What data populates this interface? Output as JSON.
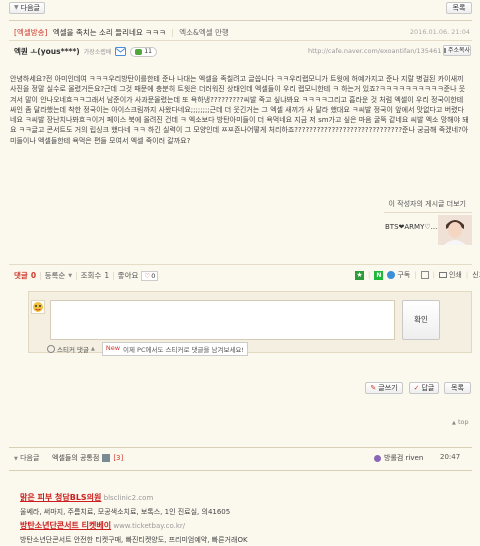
{
  "top_nav": {
    "prev_label": "다음글",
    "list_label": "목록"
  },
  "post": {
    "category": "[엑셀방송]",
    "title": "엑셀을 족치는 소리 들리네요 ㅋㅋㅋ",
    "board": "엑소&엑셀 만행",
    "date": "2016.01.06. 21:04",
    "author": "엑퀀 ㅗ(yous****)",
    "author_grade": "가장소렙배",
    "comment_count": "11",
    "url": "http://cafe.naver.com/exoantifan/135461",
    "copy_url_label": "주소복사",
    "body": "안녕하세요?전 아미인데여 ㅋㅋㅋ우리방탄이를한테 준나 나대는 엑셀을 족칠려고 글씁니다 ㅋㅋ우리랩모니가 트윗에 허예가지고 준나 지랄 병걸된 카이새끼 사진을 정말 실수로 올렸거든요?근데 그것 때문에 충분히 트윗은 더러워진 상태인데 엑셀들이 우리 랩모니한테 ㅋ 하는거 있죠?ㅋㅋㅋㅋㅋㅋㅋㅋㅋㅋ준나 웃겨서 말이 안나오네흐ㅋㅋ그래서 남준이가 사과문올렸는데 또 욕하냉?????????씨발 죽고 싶냐봐요 ㅋㅋㅋㅋ그리고 흡라운 것 처럼 엑셀이 우리 정국이한테 싸인 좀 달라했는데 착한 정국이는 아이스크림까지 사왔다네요;;;;;;;;근데 더 웃긴거는 그 엑셀 새끼가 사 달라 했대요 ㅋ씨발 정국이 앞에서 맛없다고 버렸다네요 ㅋ씨발 장난치나봐흐ㅋ이거 페이스 북에 올려진 건데 ㅋ 엑소보다 방탄아미들이 더 욕먹네요 지금 저 sm가고 싶은 마음 굴뚝 같네요 씨발 엑소 망해야 돼요 ㅋㅋ글고 콘서트도 거의 립싱크 했다네 ㅋㅋ 하긴 실력이 그 모양인데 ㅉㅉ죤나어떻게 처리하죠?????????????????????????????준나 궁금해 죽겠네?아미들이나 엑셀들한테 욕먹은 편들 모여서 엑셀 죽이러 갈까요?"
  },
  "author_more": "이 작성자의 게시글 더보기",
  "signature": {
    "text": "BTS❤ARMY♡..."
  },
  "comment_bar": {
    "comments_label": "댓글",
    "comments_count": "0",
    "sort_label": "등록순",
    "views_label": "조회수",
    "views_count": "1",
    "likes_label": "좋아요",
    "likes_count": "0",
    "subscribe_label": "구독",
    "print_label": "인쇄",
    "report_label": "신고"
  },
  "comment_form": {
    "placeholder": "",
    "submit_label": "확인",
    "sticker_label": "스티커 댓글",
    "new_badge": "New",
    "new_notice": "이제 PC에서도 스티커로 댓글을 남겨보세요!"
  },
  "actions": {
    "write_label": "글쓰기",
    "reply_label": "답글",
    "list_label": "목록",
    "top_label": "top"
  },
  "next_post": {
    "label": "다음글",
    "title": "엑셀들의 공통점",
    "comment_count": "[3]",
    "author": "방롤검 riven",
    "time": "20:47"
  },
  "ads": [
    {
      "title": "맑은 피부 청담BLS의원",
      "url": "blsclinic2.com",
      "desc": "울쎄라, 써마지, 주름치료, 모공색소치료, 보톡스, 1인 진료실, 의41605"
    },
    {
      "title": "방탄소년단콘서트 티켓베이",
      "url": "www.ticketbay.co.kr/",
      "desc": "방탄소년단콘서트 안전한 티켓구매, 빠진티켓양도, 프리미엄예약, 빠른거래OK"
    }
  ],
  "colors": {
    "background": "#fbf8ee",
    "category": "#d0392b",
    "green": "#52a63b",
    "red_link": "#cc1e1e"
  }
}
